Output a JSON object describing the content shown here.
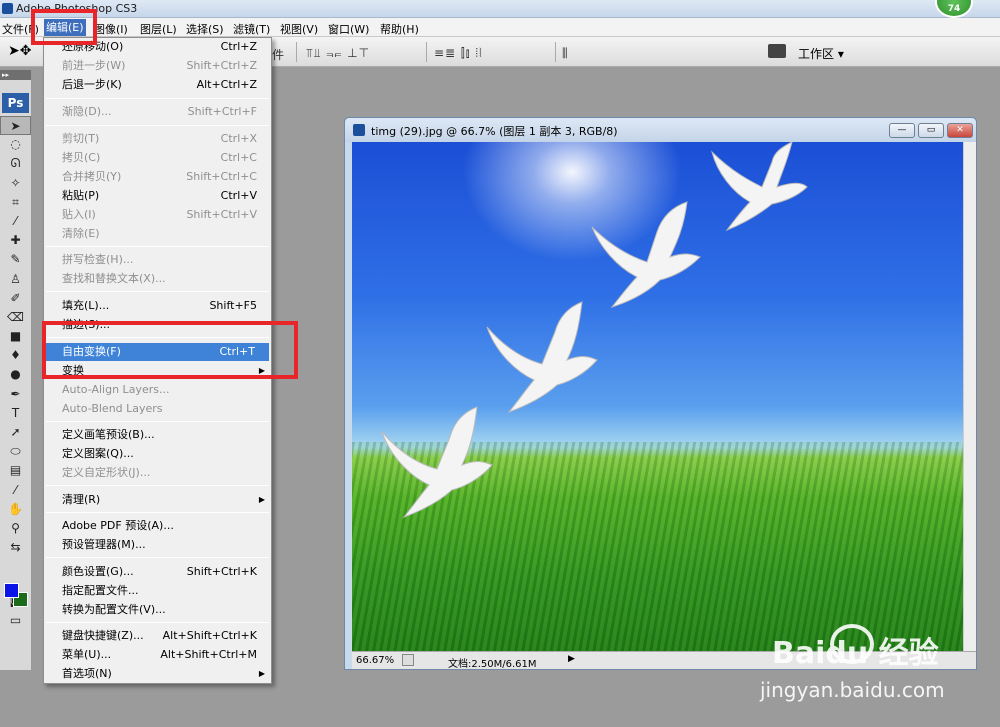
{
  "app": {
    "title": "Adobe Photoshop CS3",
    "badge_num": "74"
  },
  "menubar": {
    "items": [
      {
        "label": "文件(F)"
      },
      {
        "label": "编辑(E)"
      },
      {
        "label": "图像(I)"
      },
      {
        "label": "图层(L)"
      },
      {
        "label": "选择(S)"
      },
      {
        "label": "滤镜(T)"
      },
      {
        "label": "视图(V)"
      },
      {
        "label": "窗口(W)"
      },
      {
        "label": "帮助(H)"
      }
    ]
  },
  "options_bar": {
    "partial_label": "件",
    "workspace_label": "工作区 ▾"
  },
  "edit_menu": {
    "items": [
      {
        "label": "还原移动(O)",
        "shortcut": "Ctrl+Z",
        "enabled": true
      },
      {
        "label": "前进一步(W)",
        "shortcut": "Shift+Ctrl+Z",
        "enabled": false
      },
      {
        "label": "后退一步(K)",
        "shortcut": "Alt+Ctrl+Z",
        "enabled": true
      },
      {
        "label": "渐隐(D)...",
        "shortcut": "Shift+Ctrl+F",
        "enabled": false
      },
      {
        "label": "剪切(T)",
        "shortcut": "Ctrl+X",
        "enabled": false
      },
      {
        "label": "拷贝(C)",
        "shortcut": "Ctrl+C",
        "enabled": false
      },
      {
        "label": "合并拷贝(Y)",
        "shortcut": "Shift+Ctrl+C",
        "enabled": false
      },
      {
        "label": "粘贴(P)",
        "shortcut": "Ctrl+V",
        "enabled": true
      },
      {
        "label": "贴入(I)",
        "shortcut": "Shift+Ctrl+V",
        "enabled": false
      },
      {
        "label": "清除(E)",
        "shortcut": "",
        "enabled": false
      },
      {
        "label": "拼写检查(H)...",
        "shortcut": "",
        "enabled": false
      },
      {
        "label": "查找和替换文本(X)...",
        "shortcut": "",
        "enabled": false
      },
      {
        "label": "填充(L)...",
        "shortcut": "Shift+F5",
        "enabled": true
      },
      {
        "label": "描边(S)...",
        "shortcut": "",
        "enabled": true
      },
      {
        "label": "自由变换(F)",
        "shortcut": "Ctrl+T",
        "enabled": true,
        "highlighted": true
      },
      {
        "label": "变换",
        "shortcut": "",
        "enabled": true,
        "submenu": true
      },
      {
        "label": "Auto-Align Layers...",
        "shortcut": "",
        "enabled": false
      },
      {
        "label": "Auto-Blend Layers",
        "shortcut": "",
        "enabled": false
      },
      {
        "label": "定义画笔预设(B)...",
        "shortcut": "",
        "enabled": true
      },
      {
        "label": "定义图案(Q)...",
        "shortcut": "",
        "enabled": true
      },
      {
        "label": "定义自定形状(J)...",
        "shortcut": "",
        "enabled": false
      },
      {
        "label": "清理(R)",
        "shortcut": "",
        "enabled": true,
        "submenu": true
      },
      {
        "label": "Adobe PDF 预设(A)...",
        "shortcut": "",
        "enabled": true
      },
      {
        "label": "预设管理器(M)...",
        "shortcut": "",
        "enabled": true
      },
      {
        "label": "颜色设置(G)...",
        "shortcut": "Shift+Ctrl+K",
        "enabled": true
      },
      {
        "label": "指定配置文件...",
        "shortcut": "",
        "enabled": true
      },
      {
        "label": "转换为配置文件(V)...",
        "shortcut": "",
        "enabled": true
      },
      {
        "label": "键盘快捷键(Z)...",
        "shortcut": "Alt+Shift+Ctrl+K",
        "enabled": true
      },
      {
        "label": "菜单(U)...",
        "shortcut": "Alt+Shift+Ctrl+M",
        "enabled": true
      },
      {
        "label": "首选项(N)",
        "shortcut": "",
        "enabled": true,
        "submenu": true
      }
    ]
  },
  "document": {
    "title": "timg (29).jpg @ 66.7% (图层 1 副本 3, RGB/8)",
    "zoom": "66.67%",
    "doc_size": "文档:2.50M/6.61M"
  },
  "toolbox": {
    "logo": "Ps"
  },
  "colors": {
    "foreground": "#0a14e6",
    "background": "#1a6b1a",
    "highlight": "#3e83d8",
    "annotation": "#e8262a"
  },
  "watermark": {
    "brand": "Baidu 经验",
    "url": "jingyan.baidu.com"
  }
}
